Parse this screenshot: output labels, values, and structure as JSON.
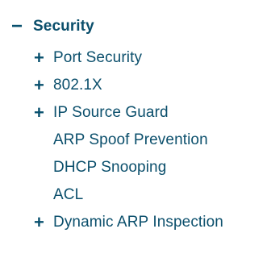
{
  "tree": {
    "root": {
      "toggle": "−",
      "label": "Security"
    },
    "items": [
      {
        "toggle": "+",
        "label": "Port Security"
      },
      {
        "toggle": "+",
        "label": "802.1X"
      },
      {
        "toggle": "+",
        "label": "IP Source Guard"
      },
      {
        "toggle": "",
        "label": "ARP Spoof Prevention"
      },
      {
        "toggle": "",
        "label": "DHCP Snooping"
      },
      {
        "toggle": "",
        "label": "ACL"
      },
      {
        "toggle": "+",
        "label": "Dynamic ARP Inspection"
      }
    ]
  },
  "colors": {
    "text": "#0b4f6c",
    "toggle": "#08506e",
    "background": "#ffffff"
  }
}
